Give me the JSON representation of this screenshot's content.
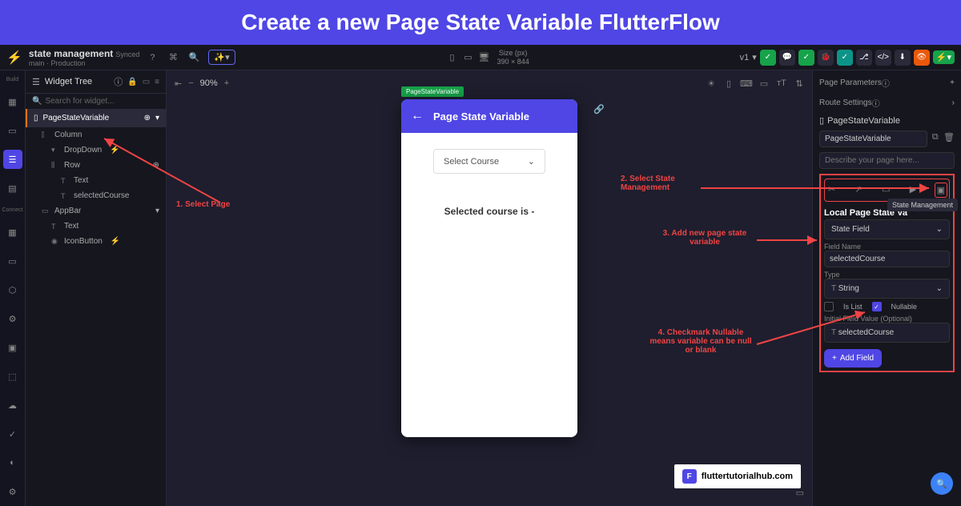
{
  "banner": {
    "title": "Create a new Page State Variable FlutterFlow"
  },
  "topbar": {
    "project_name": "state management",
    "status": "Synced",
    "branch": "main",
    "env": "Production",
    "size_label": "Size (px)",
    "size_value": "390 × 844",
    "version": "v1"
  },
  "tree": {
    "title": "Widget Tree",
    "search_placeholder": "Search for widget...",
    "page_name": "PageStateVariable",
    "items": {
      "column": "Column",
      "dropdown": "DropDown",
      "row": "Row",
      "text1": "Text",
      "selectedCourse": "selectedCourse",
      "appbar": "AppBar",
      "text2": "Text",
      "iconbutton": "IconButton"
    }
  },
  "canvas": {
    "zoom": "90%",
    "device_tag": "PageStateVariable",
    "app_title": "Page State Variable",
    "dropdown_label": "Select Course",
    "selected_text": "Selected course is -"
  },
  "right_panel": {
    "page_parameters": "Page Parameters",
    "route_settings": "Route Settings",
    "page_name_label": "PageStateVariable",
    "page_name_value": "PageStateVariable",
    "describe_placeholder": "Describe your page here...",
    "tooltip": "State Management",
    "local_state_title": "Local Page State Va",
    "state_field": "State Field",
    "field_name_label": "Field Name",
    "field_name_value": "selectedCourse",
    "type_label": "Type",
    "type_value": "String",
    "is_list": "Is List",
    "nullable": "Nullable",
    "initial_label": "Initial Field Value (Optional)",
    "initial_value": "selectedCourse",
    "add_field": "Add Field"
  },
  "annotations": {
    "a1": "1. Select Page",
    "a2": "2. Select State Management",
    "a3": "3. Add new page state variable",
    "a4": "4. Checkmark Nullable means variable can be null or blank"
  },
  "watermark": {
    "text": "fluttertutorialhub.com"
  },
  "rail_labels": {
    "build": "Build",
    "connect": "Connect"
  }
}
